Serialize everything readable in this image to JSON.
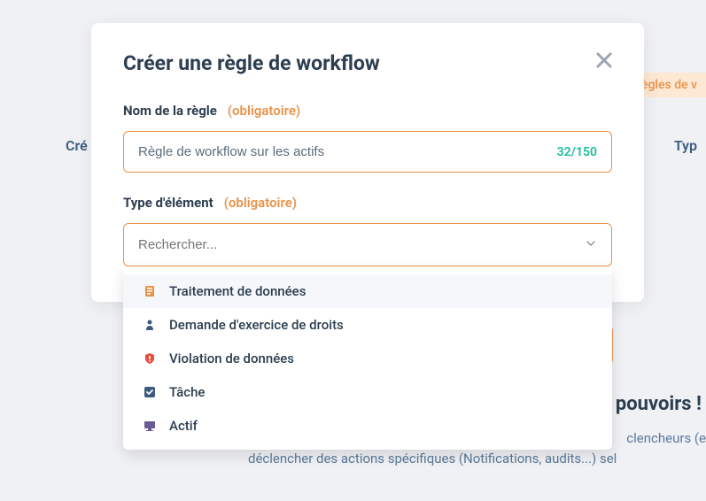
{
  "background": {
    "banner_fragment": "ègles de v",
    "left_text": "Cré",
    "right_text": "Typ",
    "hero_title_fragment": "pouvoirs !",
    "hero_sub_line1": "clencheurs (e",
    "hero_sub_line2": "déclencher des actions spécifiques (Notifications, audits...) sel"
  },
  "modal": {
    "title": "Créer une règle de workflow",
    "rule_name": {
      "label": "Nom de la règle",
      "required_tag": "(obligatoire)",
      "value": "Règle de workflow sur les actifs",
      "char_count": "32/150"
    },
    "element_type": {
      "label": "Type d'élément",
      "required_tag": "(obligatoire)",
      "placeholder": "Rechercher..."
    }
  },
  "dropdown": {
    "items": [
      {
        "label": "Traitement de données",
        "icon": "data-processing",
        "color": "#e8934a"
      },
      {
        "label": "Demande d'exercice de droits",
        "icon": "rights-request",
        "color": "#3d5a80"
      },
      {
        "label": "Violation de données",
        "icon": "breach",
        "color": "#e74c3c"
      },
      {
        "label": "Tâche",
        "icon": "task",
        "color": "#3d5a80"
      },
      {
        "label": "Actif",
        "icon": "asset",
        "color": "#6b5b95"
      }
    ]
  }
}
